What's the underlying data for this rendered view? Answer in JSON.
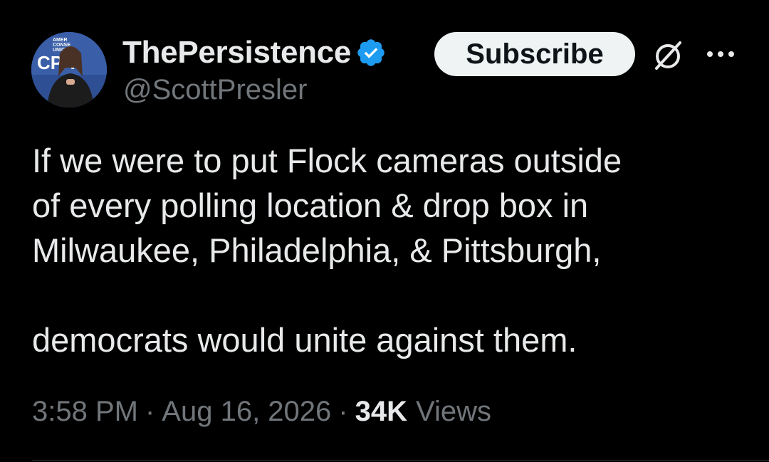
{
  "author": {
    "display_name": "ThePersistence",
    "handle": "@ScottPresler",
    "verified": true,
    "avatar_banner_text": "AMERICAN CONSERVATIVE UNION CPAC"
  },
  "actions": {
    "subscribe_label": "Subscribe",
    "grok_icon": "grok-icon",
    "more_icon": "more-horizontal-icon"
  },
  "tweet": {
    "lines": [
      "If we were to put Flock cameras outside",
      "of every polling location & drop box in",
      "Milwaukee, Philadelphia, & Pittsburgh,",
      "democrats would unite against them."
    ]
  },
  "meta": {
    "time": "3:58 PM",
    "separator": "·",
    "date": "Aug 16, 2026",
    "views_count": "34K",
    "views_label": "Views"
  },
  "colors": {
    "background": "#000000",
    "text_primary": "#e7e9ea",
    "text_secondary": "#71767b",
    "verified_blue": "#1d9bf0",
    "subscribe_bg": "#eff3f4"
  }
}
